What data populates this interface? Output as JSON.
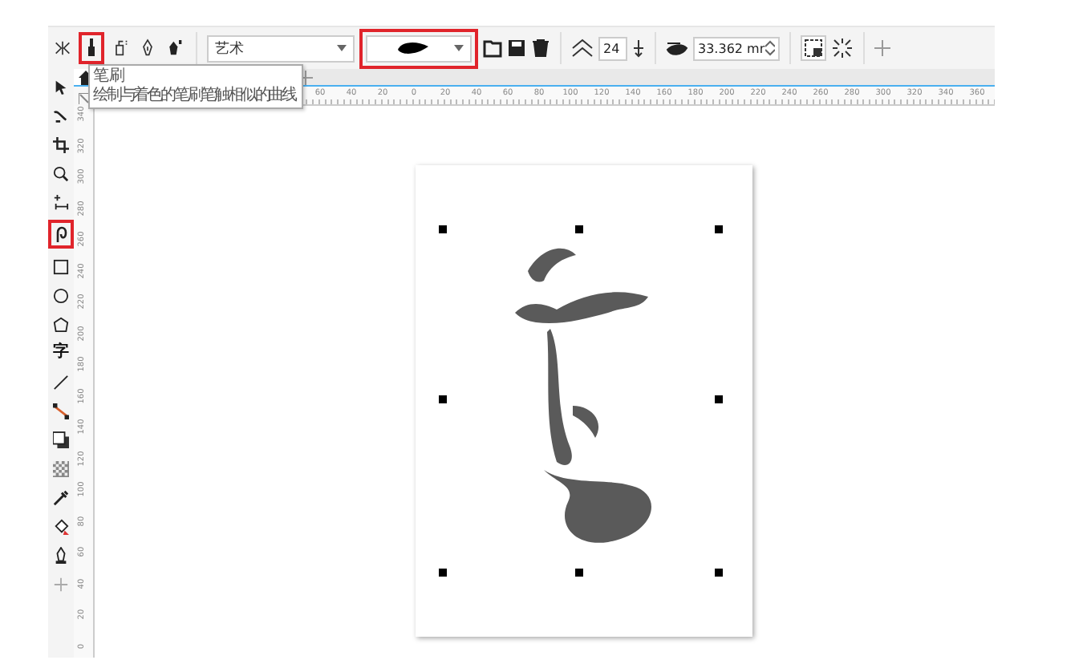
{
  "toolbar": {
    "tools": [
      {
        "kind": "mirror",
        "selected": false,
        "highlighted": false
      },
      {
        "kind": "brush",
        "selected": true,
        "highlighted": true
      },
      {
        "kind": "sprayer",
        "selected": false,
        "highlighted": false
      },
      {
        "kind": "calligraphic",
        "selected": false,
        "highlighted": false
      },
      {
        "kind": "pressure",
        "selected": false,
        "highlighted": false
      }
    ],
    "category": "艺术",
    "stroke_dropdown": {
      "highlighted": true
    },
    "smoothing": "24",
    "stroke_width": "33.362 mr"
  },
  "tooltip": {
    "title": "笔刷",
    "description": "绘制与着色的笔刷笔触相似的曲线"
  },
  "ruler_h": [
    "60",
    "40",
    "20",
    "0",
    "20",
    "40",
    "60",
    "80",
    "100",
    "120",
    "140",
    "160",
    "180",
    "200",
    "220",
    "240",
    "260",
    "280",
    "300",
    "320",
    "340",
    "360"
  ],
  "ruler_v": [
    "340",
    "320",
    "300",
    "280",
    "260",
    "240",
    "220",
    "200",
    "180",
    "160",
    "140",
    "120",
    "100",
    "80",
    "60",
    "40",
    "20",
    "0"
  ],
  "toolbox": [
    {
      "kind": "pick",
      "highlighted": false
    },
    {
      "kind": "shape",
      "highlighted": false
    },
    {
      "kind": "crop",
      "highlighted": false
    },
    {
      "kind": "zoom",
      "highlighted": false
    },
    {
      "kind": "dimension",
      "highlighted": false
    },
    {
      "kind": "artistic",
      "highlighted": true
    },
    {
      "kind": "rectangle",
      "highlighted": false
    },
    {
      "kind": "ellipse",
      "highlighted": false
    },
    {
      "kind": "polygon",
      "highlighted": false
    },
    {
      "kind": "text",
      "label": "字",
      "highlighted": false
    },
    {
      "kind": "line",
      "highlighted": false
    },
    {
      "kind": "connector",
      "highlighted": false
    },
    {
      "kind": "shadow",
      "highlighted": false
    },
    {
      "kind": "transparency",
      "highlighted": false
    },
    {
      "kind": "eyedropper",
      "highlighted": false
    },
    {
      "kind": "fill",
      "highlighted": false
    },
    {
      "kind": "smartfill",
      "highlighted": false
    },
    {
      "kind": "add",
      "highlighted": false
    }
  ]
}
